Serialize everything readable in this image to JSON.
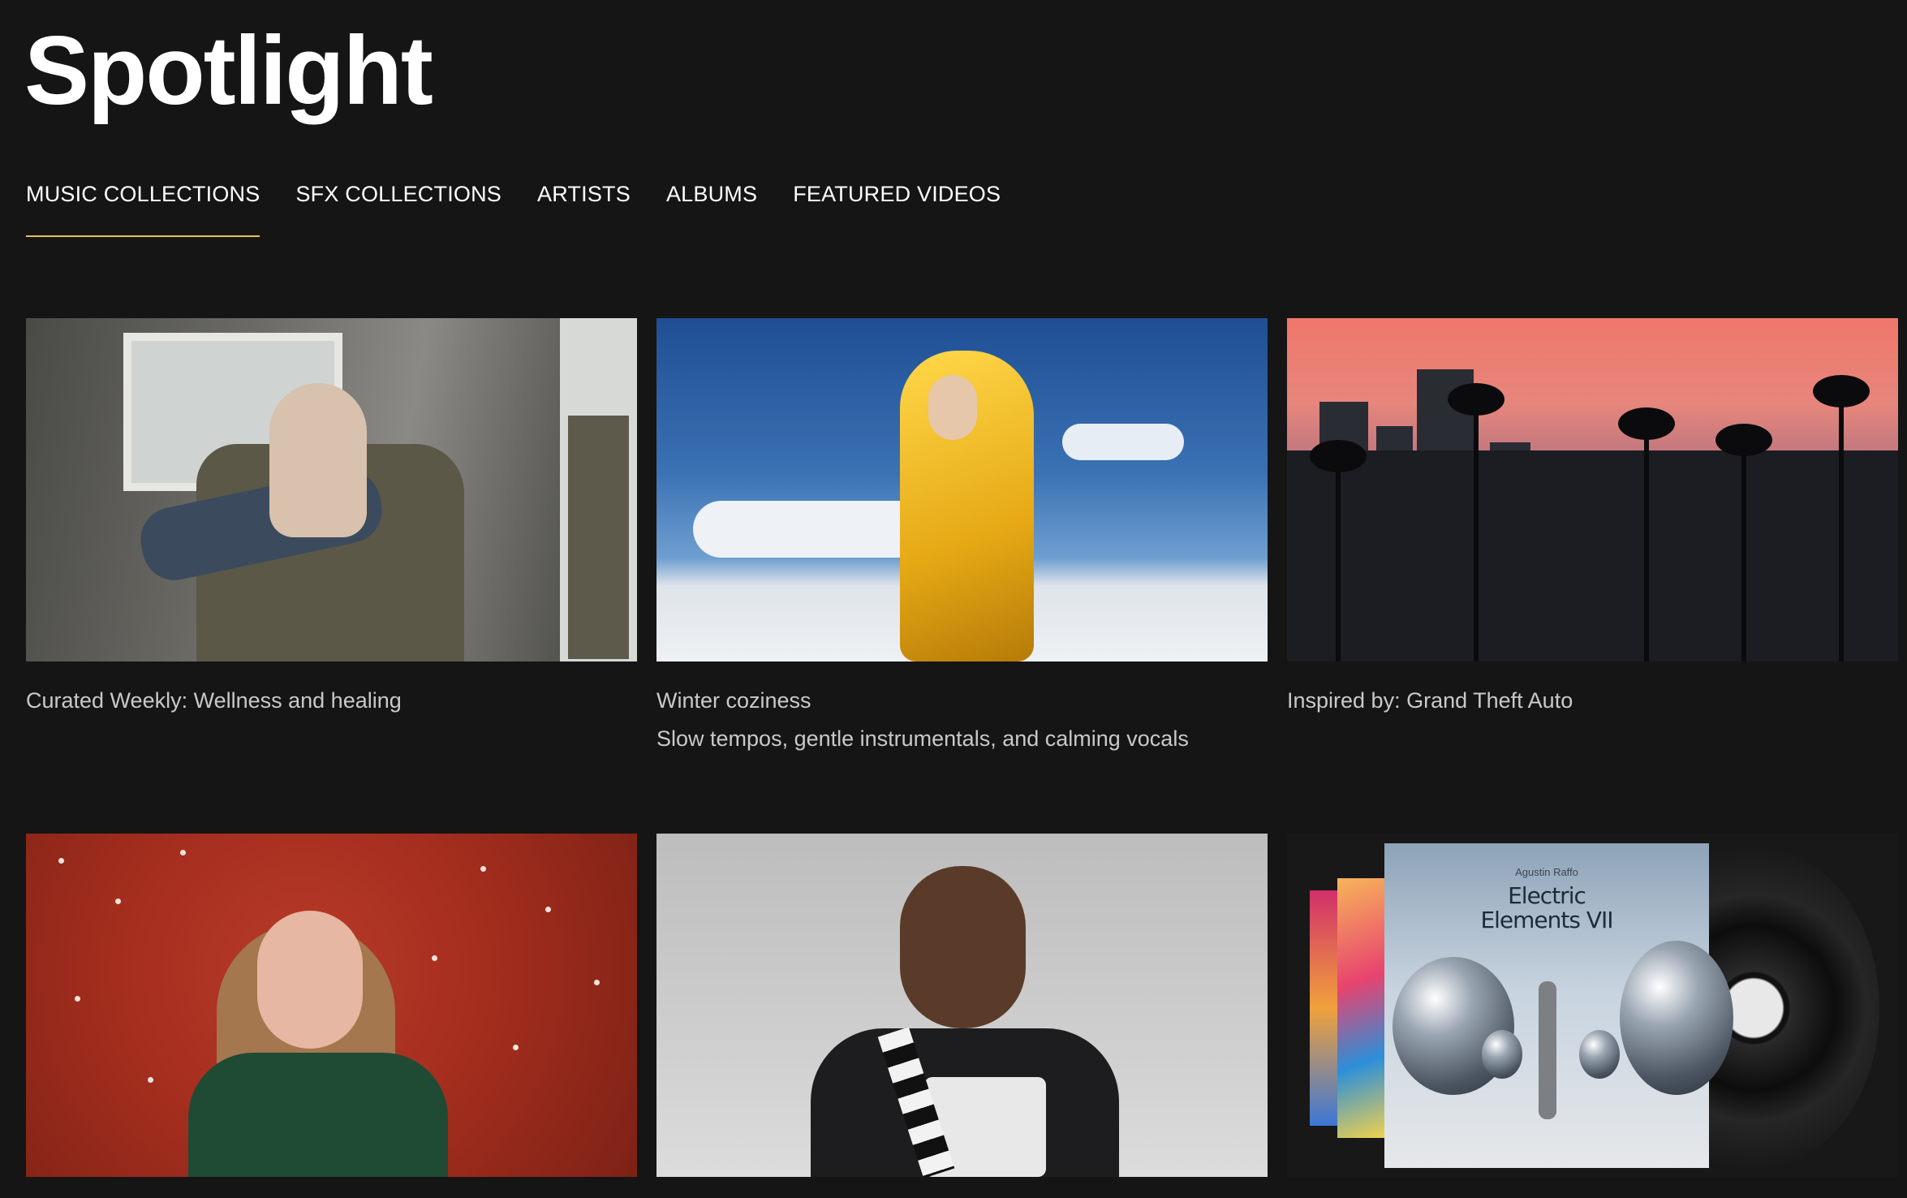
{
  "page": {
    "title": "Spotlight"
  },
  "tabs": [
    {
      "label": "MUSIC COLLECTIONS",
      "active": true
    },
    {
      "label": "SFX COLLECTIONS",
      "active": false
    },
    {
      "label": "ARTISTS",
      "active": false
    },
    {
      "label": "ALBUMS",
      "active": false
    },
    {
      "label": "FEATURED VIDEOS",
      "active": false
    }
  ],
  "accent_color": "#e9c24a",
  "cards": [
    {
      "caption": "Curated Weekly:  Wellness and healing",
      "subtitle": ""
    },
    {
      "caption": "Winter coziness",
      "subtitle": "Slow tempos, gentle instrumentals, and calming vocals"
    },
    {
      "caption": "Inspired by:  Grand Theft Auto",
      "subtitle": ""
    },
    {
      "caption": "",
      "subtitle": ""
    },
    {
      "caption": "",
      "subtitle": ""
    },
    {
      "caption": "",
      "subtitle": ""
    }
  ],
  "album_cover": {
    "artist": "Agustin Raffo",
    "title_line1": "Electric",
    "title_line2": "Elements VII"
  }
}
